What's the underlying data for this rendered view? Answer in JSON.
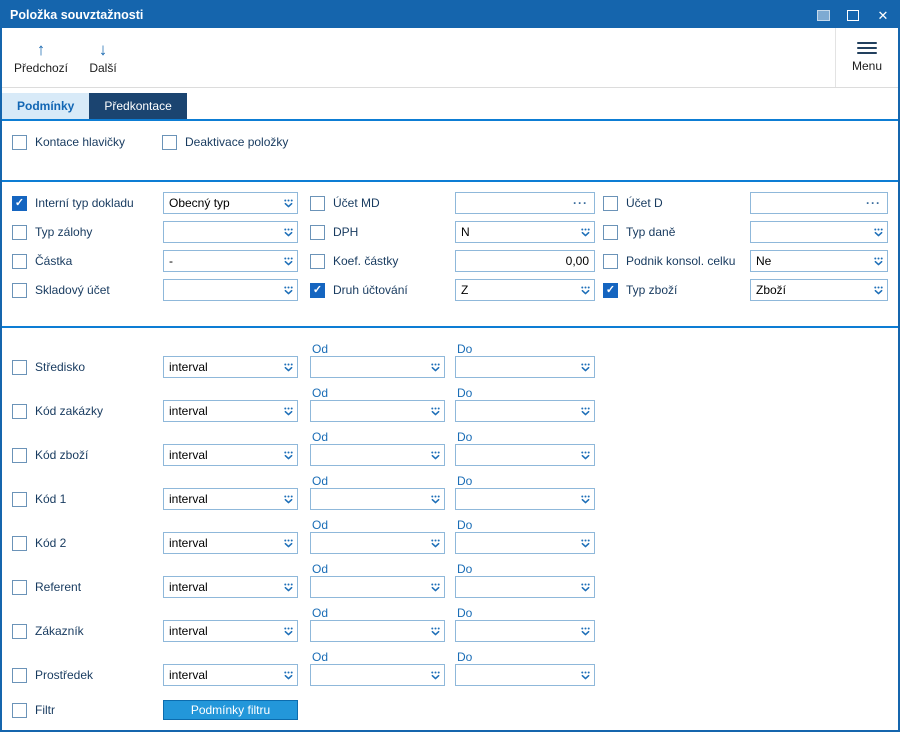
{
  "window": {
    "title": "Položka souvztažnosti"
  },
  "icons": {
    "prev_glyph": "↑",
    "next_glyph": "↓",
    "close_glyph": "✕",
    "ellipsis_glyph": "···"
  },
  "toolbar": {
    "prev": "Předchozí",
    "next": "Další",
    "menu": "Menu"
  },
  "tabs": {
    "conditions": "Podmínky",
    "precontation": "Předkontace"
  },
  "header_checks": {
    "kontace": "Kontace hlavičky",
    "deaktivace": "Deaktivace položky"
  },
  "form": {
    "r1c1_label": "Interní typ dokladu",
    "r1c1_value": "Obecný typ",
    "r1c2_label": "Účet MD",
    "r1c2_value": "",
    "r1c3_label": "Účet D",
    "r1c3_value": "",
    "r2c1_label": "Typ zálohy",
    "r2c1_value": "",
    "r2c2_label": "DPH",
    "r2c2_value": "N",
    "r2c3_label": "Typ daně",
    "r2c3_value": "",
    "r3c1_label": "Částka",
    "r3c1_value": "-",
    "r3c2_label": "Koef. částky",
    "r3c2_value": "0,00",
    "r3c3_label": "Podnik konsol. celku",
    "r3c3_value": "Ne",
    "r4c1_label": "Skladový účet",
    "r4c1_value": "",
    "r4c2_label": "Druh účtování",
    "r4c2_value": "Z",
    "r4c3_label": "Typ zboží",
    "r4c3_value": "Zboží"
  },
  "checks": {
    "kontace": false,
    "deaktivace": false,
    "r1c1": true,
    "r1c2": false,
    "r1c3": false,
    "r2c1": false,
    "r2c2": false,
    "r2c3": false,
    "r3c1": false,
    "r3c2": false,
    "r3c3": false,
    "r4c1": false,
    "r4c2": true,
    "r4c3": true,
    "i0": false,
    "i1": false,
    "i2": false,
    "i3": false,
    "i4": false,
    "i5": false,
    "i6": false,
    "i7": false,
    "filtr": false
  },
  "intervals": {
    "od": "Od",
    "do": "Do",
    "rows": [
      {
        "label": "Středisko",
        "value": "interval",
        "od": "",
        "do": ""
      },
      {
        "label": "Kód zakázky",
        "value": "interval",
        "od": "",
        "do": ""
      },
      {
        "label": "Kód zboží",
        "value": "interval",
        "od": "",
        "do": ""
      },
      {
        "label": "Kód 1",
        "value": "interval",
        "od": "",
        "do": ""
      },
      {
        "label": "Kód 2",
        "value": "interval",
        "od": "",
        "do": ""
      },
      {
        "label": "Referent",
        "value": "interval",
        "od": "",
        "do": ""
      },
      {
        "label": "Zákazník",
        "value": "interval",
        "od": "",
        "do": ""
      },
      {
        "label": "Prostředek",
        "value": "interval",
        "od": "",
        "do": ""
      }
    ]
  },
  "filter": {
    "label": "Filtr",
    "button": "Podmínky filtru"
  }
}
